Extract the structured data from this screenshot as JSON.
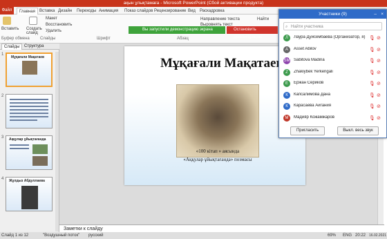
{
  "window": {
    "title": "ақын ұлықтамаға - Microsoft PowerPoint (Сбой активации продукта)"
  },
  "ribbon_tabs": [
    "Файл",
    "Главная",
    "Вставка",
    "Дизайн",
    "Переходы",
    "Анимация",
    "Показ слайдов",
    "Рецензирование",
    "Вид",
    "Раскадровка"
  ],
  "ribbon": {
    "paste": "Вставить",
    "create": "Создать слайд",
    "layout": "Макет",
    "restore": "Восстановить",
    "delete": "Удалить",
    "direction": "Направление текста",
    "align": "Выровнять текст",
    "find": "Найти",
    "replace": "Заменить",
    "select": "Выделить",
    "group_buffer": "Буфер обмена",
    "group_slides": "Слайды",
    "group_font": "Шрифт",
    "group_paragraph": "Абзац"
  },
  "notifications": {
    "green": "Вы запустили демонстрацию экрана",
    "red": "Остановить демонстрацию"
  },
  "left_tabs": [
    "Слайды",
    "Структура"
  ],
  "thumbs": [
    "1",
    "2",
    "3",
    "4"
  ],
  "thumb1_title": "Мұқағали Мақатаев",
  "thumb3_title": "Аққулар ұйықтағанда",
  "thumb4_title": "Жұлдыз Абдуллаева",
  "slide": {
    "title": "Мұқағали Мақатаев",
    "caption1": "«100 кітап » аясында",
    "caption2": "«Аққулар ұйықтағанда» поэмасы"
  },
  "notes": "Заметки к слайду",
  "status": {
    "slide": "Слайд 1 из 12",
    "theme": "\"Воздушный поток\"",
    "lang": "русский",
    "zoom": "69%",
    "kb": "ENG",
    "time": "20:22",
    "date": "16.02.2021"
  },
  "participants": {
    "title": "Участники (9)",
    "search": "Найти участника",
    "invite": "Пригласить",
    "mute_all": "Выкл. весь звук",
    "list": [
      {
        "initial": "Л",
        "name": "Лаура Дуйсембаева (Организатор, я)",
        "color": "#3c9a4c"
      },
      {
        "initial": "A",
        "name": "Asset Abilov",
        "color": "#666"
      },
      {
        "initial": "SM",
        "name": "Sabitova Madina",
        "color": "#8e44ad"
      },
      {
        "initial": "Z",
        "name": "Zhakiybek Yerkengali",
        "color": "#3c9a4c"
      },
      {
        "initial": "Е",
        "name": "Ержан Сериков",
        "color": "#3c9a4c"
      },
      {
        "initial": "К",
        "name": "Капсалимова Дана",
        "color": "#2f6bc8"
      },
      {
        "initial": "К",
        "name": "Карасаева Айгания",
        "color": "#2f6bc8"
      },
      {
        "initial": "М",
        "name": "Мадияр Кожамжаров",
        "color": "#c0392b"
      }
    ]
  }
}
